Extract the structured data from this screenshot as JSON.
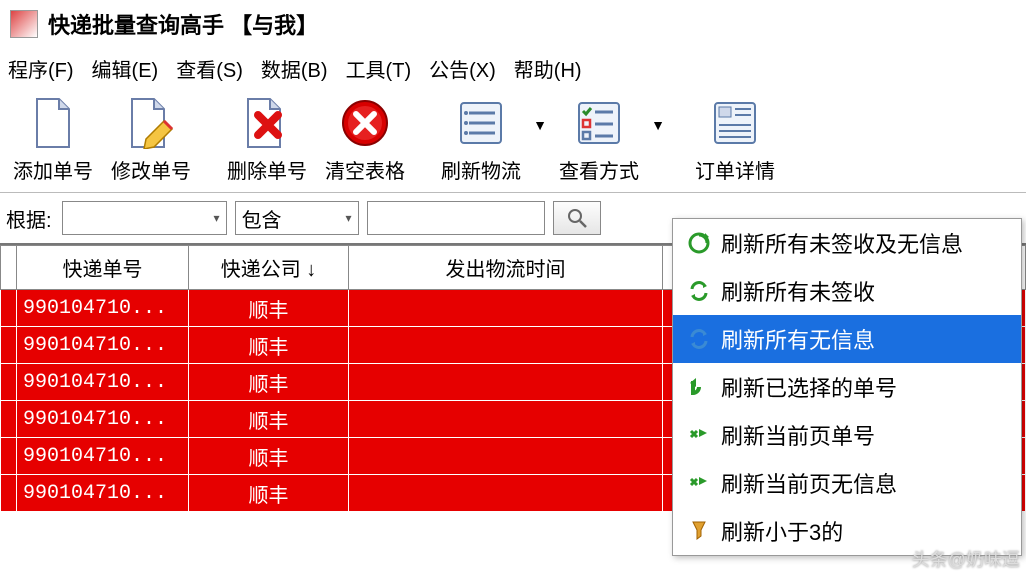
{
  "title": "快递批量查询高手  【与我】",
  "menu": [
    "程序(F)",
    "编辑(E)",
    "查看(S)",
    "数据(B)",
    "工具(T)",
    "公告(X)",
    "帮助(H)"
  ],
  "toolbar": {
    "add": "添加单号",
    "edit": "修改单号",
    "del": "删除单号",
    "clear": "清空表格",
    "refresh": "刷新物流",
    "view": "查看方式",
    "detail": "订单详情"
  },
  "filter": {
    "label": "根据:",
    "combo1": "",
    "combo2": "包含",
    "input": "",
    "search_icon": "search-icon"
  },
  "columns": [
    "快递单号",
    "快递公司  ↓",
    "发出物流时间"
  ],
  "rows": [
    {
      "no": "990104710...",
      "co": "顺丰"
    },
    {
      "no": "990104710...",
      "co": "顺丰"
    },
    {
      "no": "990104710...",
      "co": "顺丰"
    },
    {
      "no": "990104710...",
      "co": "顺丰"
    },
    {
      "no": "990104710...",
      "co": "顺丰"
    },
    {
      "no": "990104710...",
      "co": "顺丰"
    }
  ],
  "dropdown": [
    {
      "label": "刷新所有未签收及无信息",
      "selected": false
    },
    {
      "label": "刷新所有未签收",
      "selected": false
    },
    {
      "label": "刷新所有无信息",
      "selected": true
    },
    {
      "label": "刷新已选择的单号",
      "selected": false
    },
    {
      "label": "刷新当前页单号",
      "selected": false
    },
    {
      "label": "刷新当前页无信息",
      "selected": false
    },
    {
      "label": "刷新小于3的",
      "selected": false
    }
  ],
  "footer": "头条@奶味逗"
}
